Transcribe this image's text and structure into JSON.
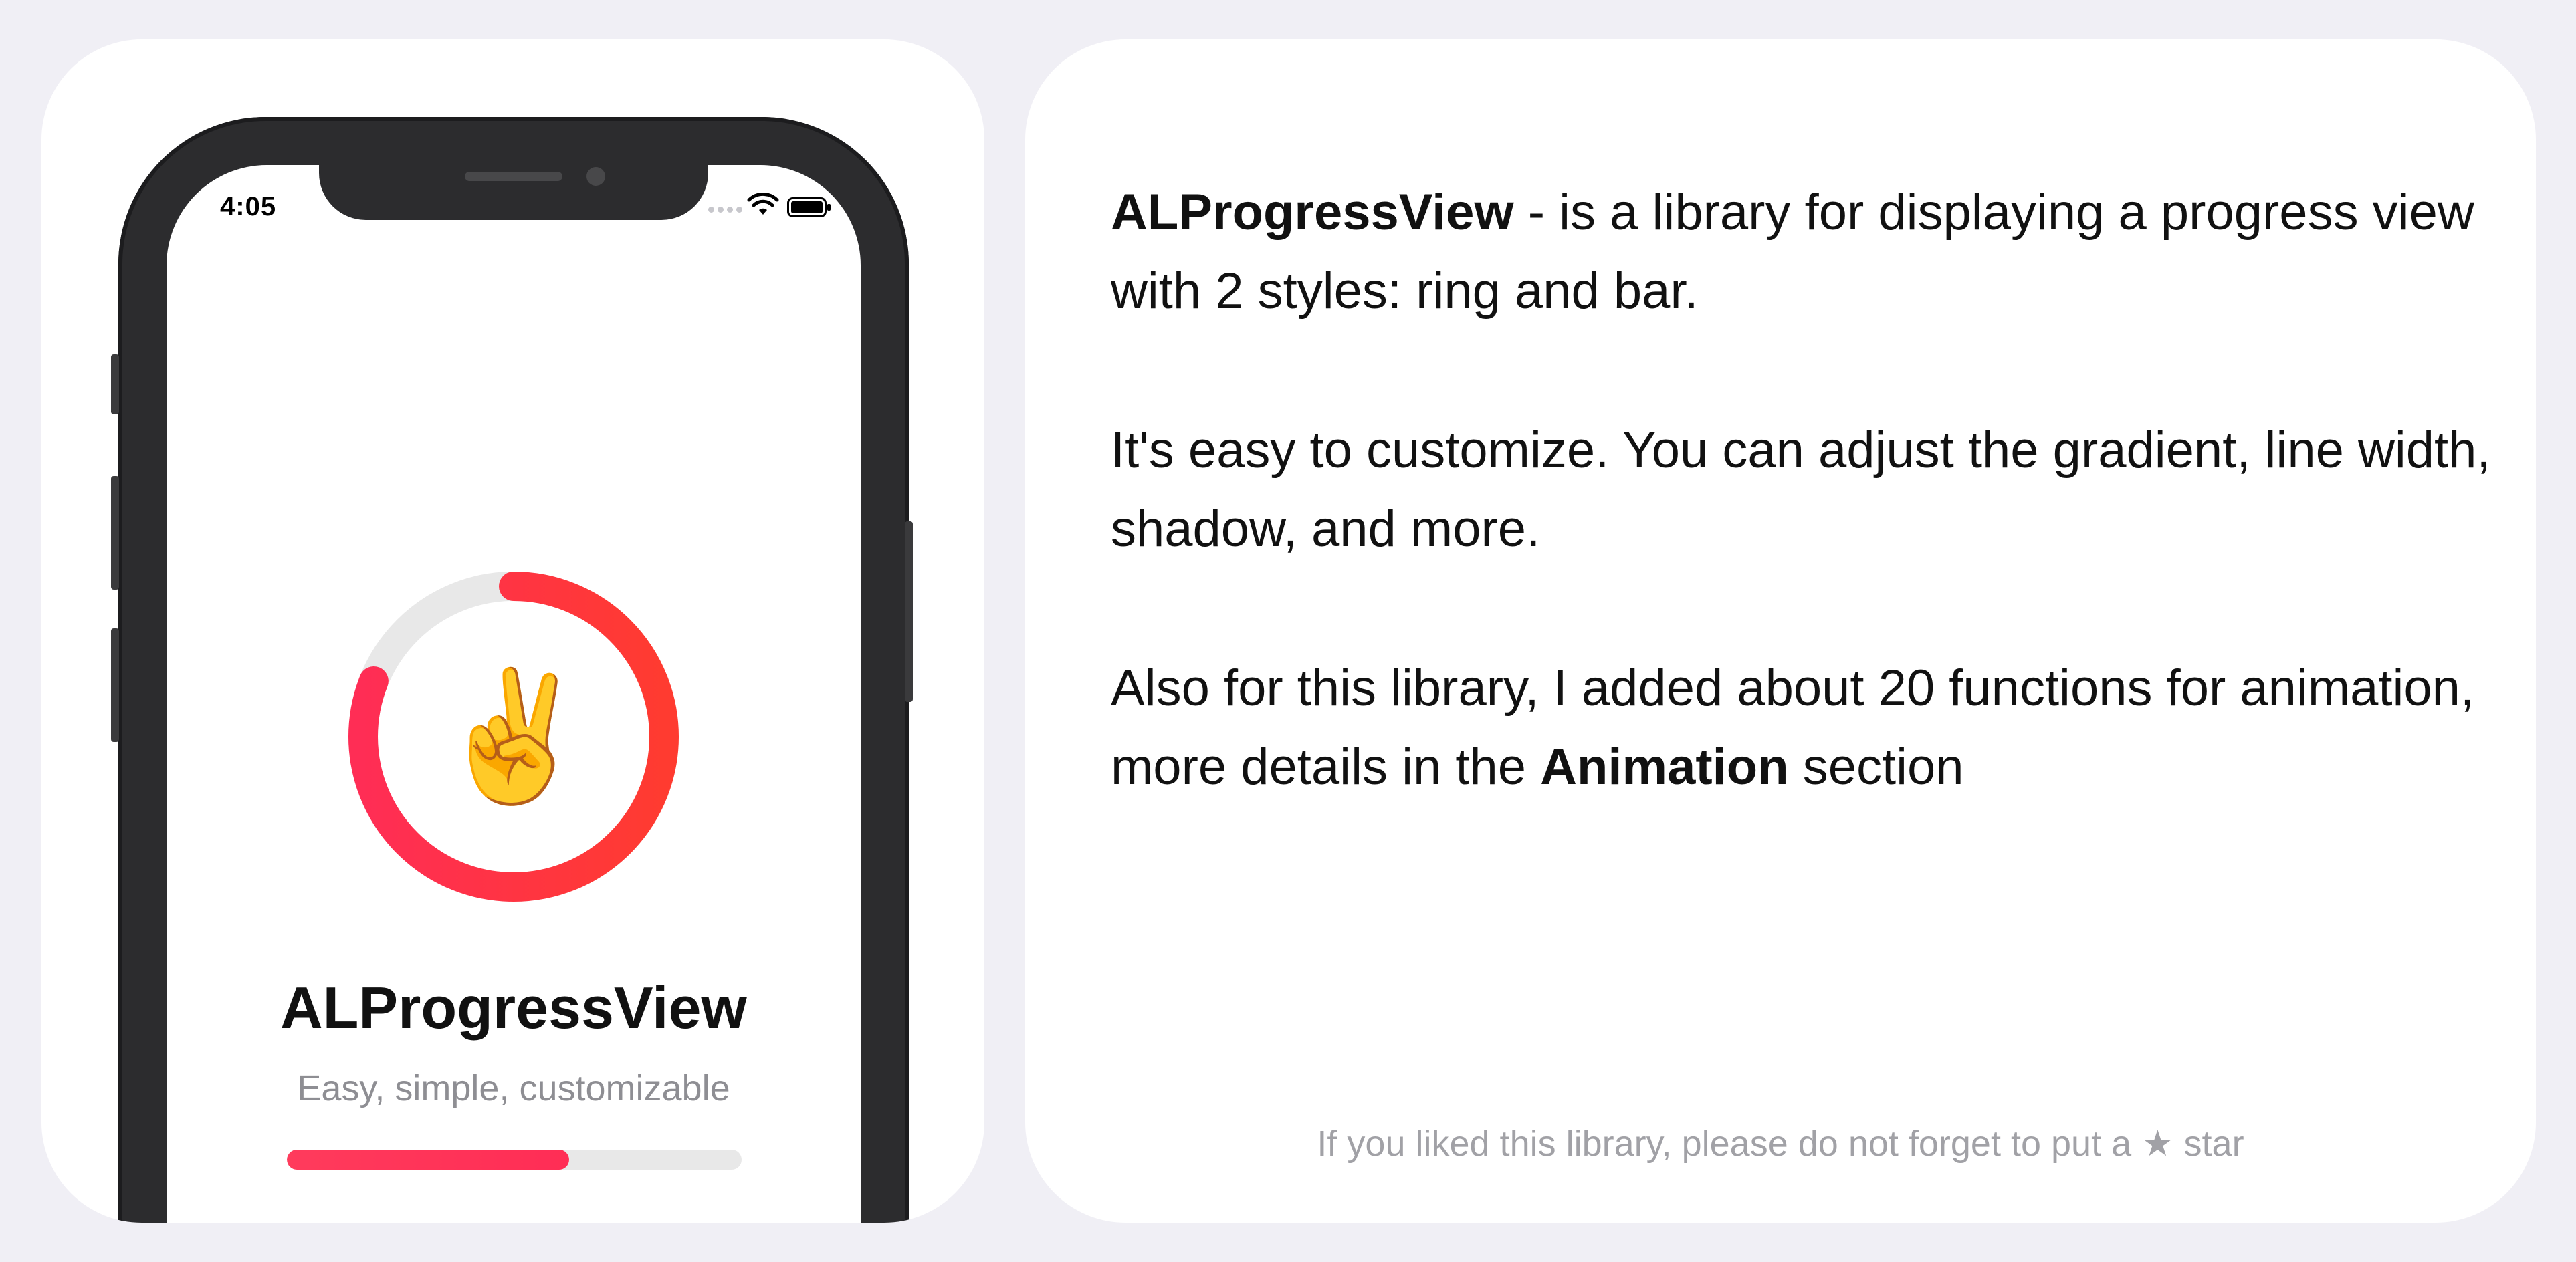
{
  "colors": {
    "background": "#f0eff5",
    "card": "#ffffff",
    "accent_start": "#ff2d55",
    "accent_end": "#ff3b30",
    "track": "#e8e8e8"
  },
  "phone": {
    "status_time": "4:05",
    "icons": [
      "signal-dots-icon",
      "wifi-icon",
      "battery-icon"
    ],
    "ring_emoji": "✌️",
    "ring_progress": 0.81,
    "title": "ALProgressView",
    "subtitle": "Easy, simple, customizable",
    "bar_progress": 0.62
  },
  "description": {
    "p1_bold": "ALProgressView",
    "p1_rest": " - is a library for displaying a progress view with 2 styles: ring and bar.",
    "p2": "It's easy to customize. You can adjust the gradient, line width, shadow, and more.",
    "p3_text": "Also for this library, I added about 20 functions for animation, more details in the ",
    "p3_bold": "Animation",
    "p3_end": " section"
  },
  "footer": {
    "text_before": "If you liked this library, please do not forget to put a ",
    "star": "★",
    "text_after": " star"
  }
}
